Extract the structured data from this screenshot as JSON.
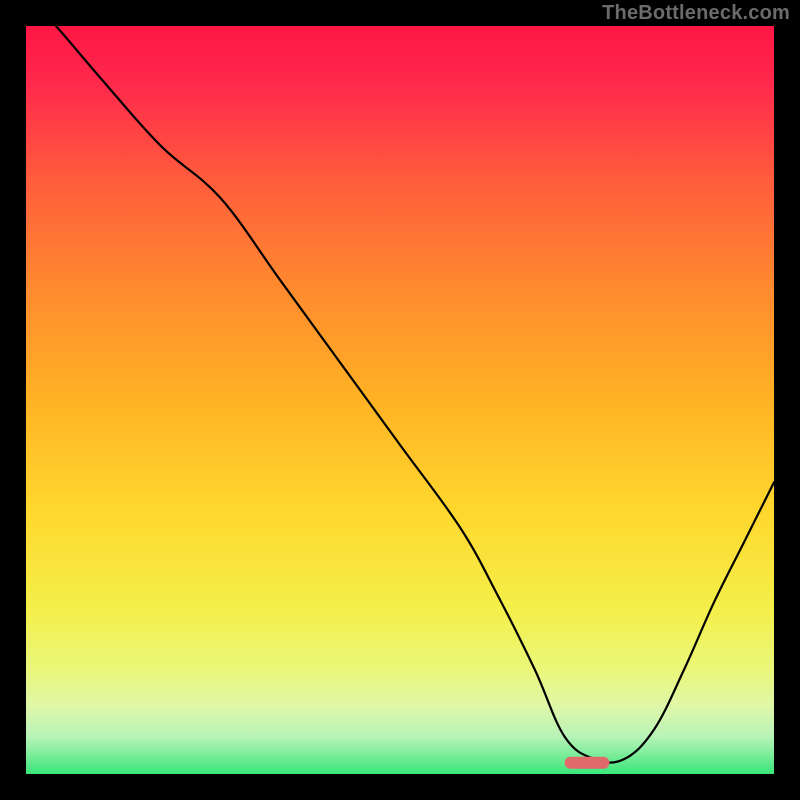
{
  "watermark": "TheBottleneck.com",
  "chart_data": {
    "type": "line",
    "title": "",
    "xlabel": "",
    "ylabel": "",
    "xlim": [
      0,
      100
    ],
    "ylim": [
      0,
      100
    ],
    "x": [
      0,
      4,
      10,
      18,
      26,
      34,
      42,
      50,
      58,
      63,
      68,
      72,
      76,
      80,
      84,
      88,
      92,
      96,
      100
    ],
    "values": [
      104,
      100,
      93,
      84,
      77,
      66,
      55,
      44,
      33,
      24,
      14,
      5,
      2,
      2,
      6,
      14,
      23,
      31,
      39
    ],
    "annotations": [
      {
        "type": "marker",
        "x_start": 72,
        "x_end": 78,
        "y": 1.5,
        "color": "#e06a6a"
      }
    ],
    "gradient_stops": [
      {
        "offset": 0.0,
        "color": "#ff1744"
      },
      {
        "offset": 0.08,
        "color": "#ff2a4c"
      },
      {
        "offset": 0.2,
        "color": "#ff5a3d"
      },
      {
        "offset": 0.35,
        "color": "#ff8a2e"
      },
      {
        "offset": 0.5,
        "color": "#ffb224"
      },
      {
        "offset": 0.65,
        "color": "#ffd82e"
      },
      {
        "offset": 0.78,
        "color": "#f4ef4a"
      },
      {
        "offset": 0.86,
        "color": "#eaf77a"
      },
      {
        "offset": 0.91,
        "color": "#dff7a8"
      },
      {
        "offset": 0.95,
        "color": "#b8f3b8"
      },
      {
        "offset": 1.0,
        "color": "#39e67a"
      }
    ]
  }
}
